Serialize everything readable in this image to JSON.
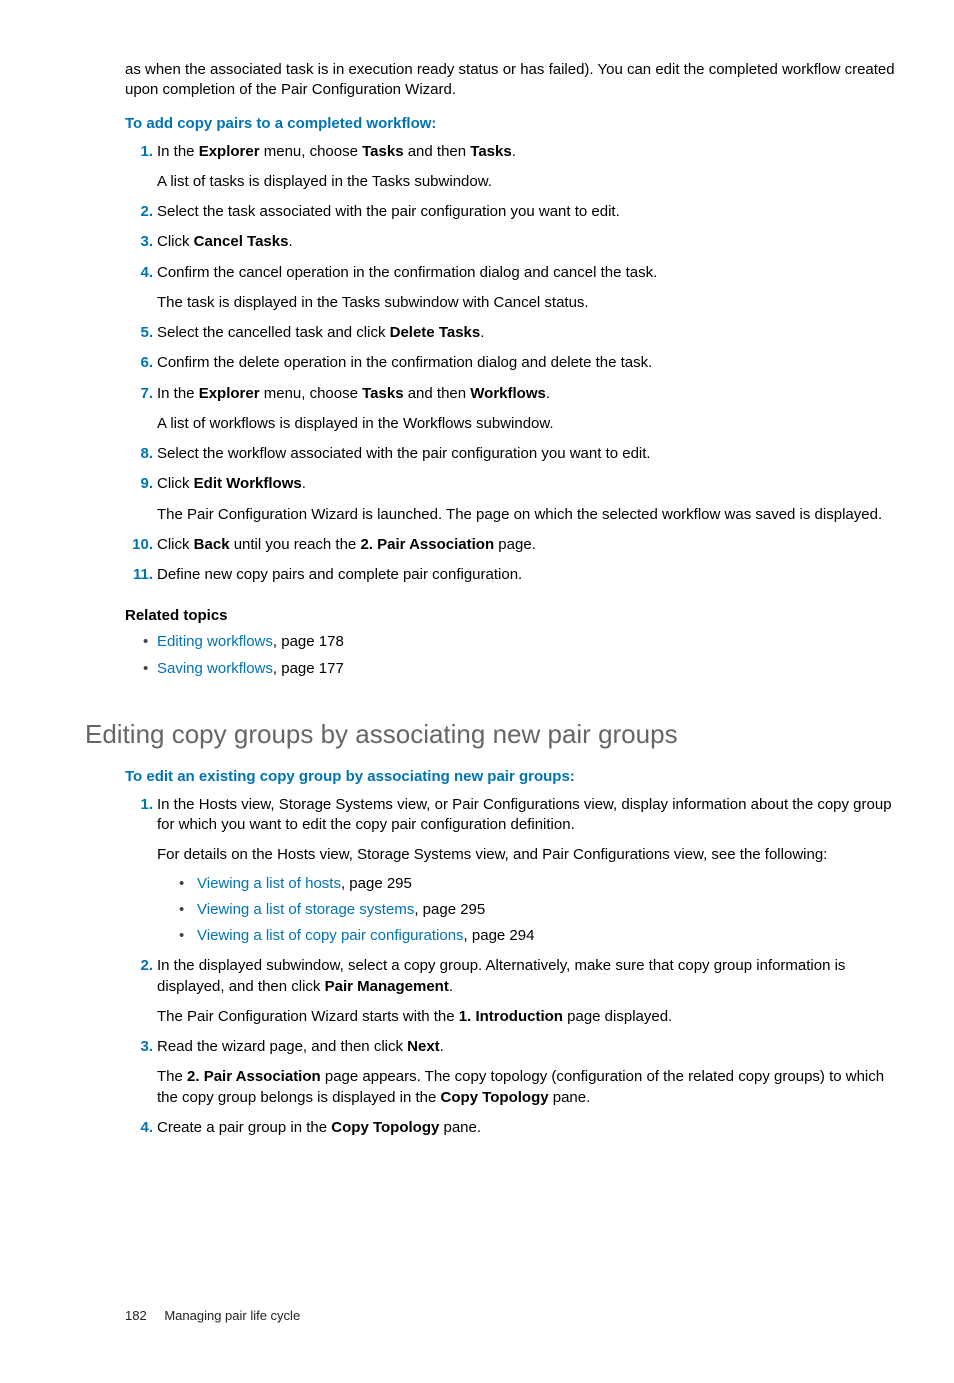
{
  "intro": "as when the associated task is in execution ready status or has failed). You can edit the completed workflow created upon completion of the Pair Configuration Wizard.",
  "heading1": "To add copy pairs to a completed workflow:",
  "steps1": [
    {
      "n": "1.",
      "pre": "In the ",
      "b1": "Explorer",
      "mid": " menu, choose ",
      "b2": "Tasks",
      "mid2": " and then ",
      "b3": "Tasks",
      "post": ".",
      "sub": "A list of tasks is displayed in the Tasks subwindow."
    },
    {
      "n": "2.",
      "text": "Select the task associated with the pair configuration you want to edit."
    },
    {
      "n": "3.",
      "pre": "Click ",
      "b1": "Cancel Tasks",
      "post": "."
    },
    {
      "n": "4.",
      "text": "Confirm the cancel operation in the confirmation dialog and cancel the task.",
      "sub": "The task is displayed in the Tasks subwindow with Cancel status."
    },
    {
      "n": "5.",
      "pre": "Select the cancelled task and click ",
      "b1": "Delete Tasks",
      "post": "."
    },
    {
      "n": "6.",
      "text": "Confirm the delete operation in the confirmation dialog and delete the task."
    },
    {
      "n": "7.",
      "pre": "In the ",
      "b1": "Explorer",
      "mid": " menu, choose ",
      "b2": "Tasks",
      "mid2": " and then ",
      "b3": "Workflows",
      "post": ".",
      "sub": "A list of workflows is displayed in the Workflows subwindow."
    },
    {
      "n": "8.",
      "text": "Select the workflow associated with the pair configuration you want to edit."
    },
    {
      "n": "9.",
      "pre": "Click ",
      "b1": "Edit Workflows",
      "post": ".",
      "sub": "The Pair Configuration Wizard is launched. The page on which the selected workflow was saved is displayed."
    },
    {
      "n": "10.",
      "pre": "Click ",
      "b1": "Back",
      "mid": " until you reach the ",
      "b2": "2. Pair Association",
      "post": " page."
    },
    {
      "n": "11.",
      "text": "Define new copy pairs and complete pair configuration."
    }
  ],
  "related_heading": "Related topics",
  "related": [
    {
      "link": "Editing workflows",
      "rest": ", page 178"
    },
    {
      "link": "Saving workflows",
      "rest": ", page 177"
    }
  ],
  "section_title": "Editing copy groups by associating new pair groups",
  "heading2": "To edit an existing copy group by associating new pair groups:",
  "steps2": {
    "s1": {
      "n": "1.",
      "text": "In the Hosts view, Storage Systems view, or Pair Configurations view, display information about the copy group for which you want to edit the copy pair configuration definition.",
      "sub": "For details on the Hosts view, Storage Systems view, and Pair Configurations view, see the following:",
      "links": [
        {
          "link": "Viewing a list of hosts",
          "rest": ", page 295"
        },
        {
          "link": "Viewing a list of storage systems",
          "rest": ", page 295"
        },
        {
          "link": "Viewing a list of copy pair configurations",
          "rest": ", page 294"
        }
      ]
    },
    "s2": {
      "n": "2.",
      "pre": "In the displayed subwindow, select a copy group. Alternatively, make sure that copy group information is displayed, and then click ",
      "b1": "Pair Management",
      "post": ".",
      "sub_pre": "The Pair Configuration Wizard starts with the ",
      "sub_b": "1. Introduction",
      "sub_post": " page displayed."
    },
    "s3": {
      "n": "3.",
      "pre": "Read the wizard page, and then click ",
      "b1": "Next",
      "post": ".",
      "sub_pre": "The ",
      "sub_b": "2. Pair Association",
      "sub_mid": " page appears. The copy topology (configuration of the related copy groups) to which the copy group belongs is displayed in the ",
      "sub_b2": "Copy Topology",
      "sub_post": " pane."
    },
    "s4": {
      "n": "4.",
      "pre": "Create a pair group in the ",
      "b1": "Copy Topology",
      "post": " pane."
    }
  },
  "footer": {
    "page": "182",
    "title": "Managing pair life cycle"
  }
}
